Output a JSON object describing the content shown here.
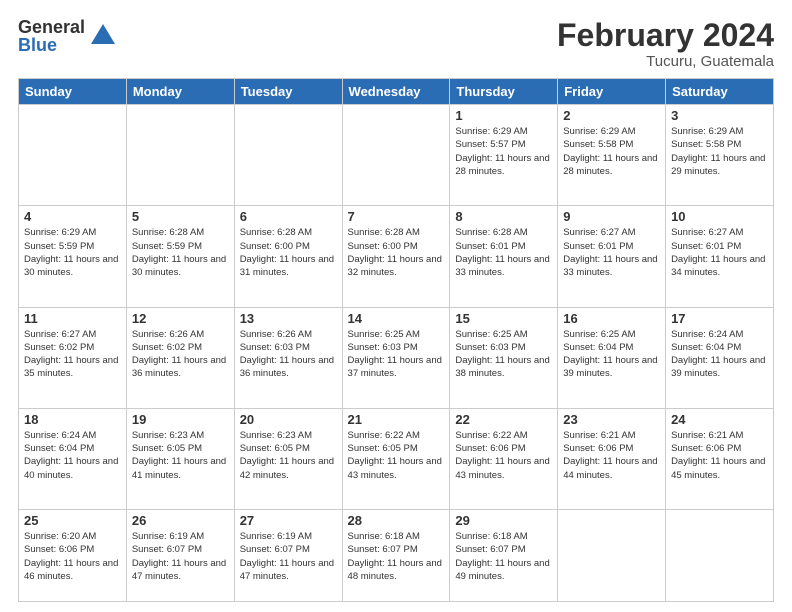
{
  "logo": {
    "general": "General",
    "blue": "Blue"
  },
  "header": {
    "month": "February 2024",
    "location": "Tucuru, Guatemala"
  },
  "weekdays": [
    "Sunday",
    "Monday",
    "Tuesday",
    "Wednesday",
    "Thursday",
    "Friday",
    "Saturday"
  ],
  "weeks": [
    [
      {
        "day": "",
        "info": ""
      },
      {
        "day": "",
        "info": ""
      },
      {
        "day": "",
        "info": ""
      },
      {
        "day": "",
        "info": ""
      },
      {
        "day": "1",
        "sunrise": "6:29 AM",
        "sunset": "5:57 PM",
        "daylight": "11 hours and 28 minutes."
      },
      {
        "day": "2",
        "sunrise": "6:29 AM",
        "sunset": "5:58 PM",
        "daylight": "11 hours and 28 minutes."
      },
      {
        "day": "3",
        "sunrise": "6:29 AM",
        "sunset": "5:58 PM",
        "daylight": "11 hours and 29 minutes."
      }
    ],
    [
      {
        "day": "4",
        "sunrise": "6:29 AM",
        "sunset": "5:59 PM",
        "daylight": "11 hours and 30 minutes."
      },
      {
        "day": "5",
        "sunrise": "6:28 AM",
        "sunset": "5:59 PM",
        "daylight": "11 hours and 30 minutes."
      },
      {
        "day": "6",
        "sunrise": "6:28 AM",
        "sunset": "6:00 PM",
        "daylight": "11 hours and 31 minutes."
      },
      {
        "day": "7",
        "sunrise": "6:28 AM",
        "sunset": "6:00 PM",
        "daylight": "11 hours and 32 minutes."
      },
      {
        "day": "8",
        "sunrise": "6:28 AM",
        "sunset": "6:01 PM",
        "daylight": "11 hours and 33 minutes."
      },
      {
        "day": "9",
        "sunrise": "6:27 AM",
        "sunset": "6:01 PM",
        "daylight": "11 hours and 33 minutes."
      },
      {
        "day": "10",
        "sunrise": "6:27 AM",
        "sunset": "6:01 PM",
        "daylight": "11 hours and 34 minutes."
      }
    ],
    [
      {
        "day": "11",
        "sunrise": "6:27 AM",
        "sunset": "6:02 PM",
        "daylight": "11 hours and 35 minutes."
      },
      {
        "day": "12",
        "sunrise": "6:26 AM",
        "sunset": "6:02 PM",
        "daylight": "11 hours and 36 minutes."
      },
      {
        "day": "13",
        "sunrise": "6:26 AM",
        "sunset": "6:03 PM",
        "daylight": "11 hours and 36 minutes."
      },
      {
        "day": "14",
        "sunrise": "6:25 AM",
        "sunset": "6:03 PM",
        "daylight": "11 hours and 37 minutes."
      },
      {
        "day": "15",
        "sunrise": "6:25 AM",
        "sunset": "6:03 PM",
        "daylight": "11 hours and 38 minutes."
      },
      {
        "day": "16",
        "sunrise": "6:25 AM",
        "sunset": "6:04 PM",
        "daylight": "11 hours and 39 minutes."
      },
      {
        "day": "17",
        "sunrise": "6:24 AM",
        "sunset": "6:04 PM",
        "daylight": "11 hours and 39 minutes."
      }
    ],
    [
      {
        "day": "18",
        "sunrise": "6:24 AM",
        "sunset": "6:04 PM",
        "daylight": "11 hours and 40 minutes."
      },
      {
        "day": "19",
        "sunrise": "6:23 AM",
        "sunset": "6:05 PM",
        "daylight": "11 hours and 41 minutes."
      },
      {
        "day": "20",
        "sunrise": "6:23 AM",
        "sunset": "6:05 PM",
        "daylight": "11 hours and 42 minutes."
      },
      {
        "day": "21",
        "sunrise": "6:22 AM",
        "sunset": "6:05 PM",
        "daylight": "11 hours and 43 minutes."
      },
      {
        "day": "22",
        "sunrise": "6:22 AM",
        "sunset": "6:06 PM",
        "daylight": "11 hours and 43 minutes."
      },
      {
        "day": "23",
        "sunrise": "6:21 AM",
        "sunset": "6:06 PM",
        "daylight": "11 hours and 44 minutes."
      },
      {
        "day": "24",
        "sunrise": "6:21 AM",
        "sunset": "6:06 PM",
        "daylight": "11 hours and 45 minutes."
      }
    ],
    [
      {
        "day": "25",
        "sunrise": "6:20 AM",
        "sunset": "6:06 PM",
        "daylight": "11 hours and 46 minutes."
      },
      {
        "day": "26",
        "sunrise": "6:19 AM",
        "sunset": "6:07 PM",
        "daylight": "11 hours and 47 minutes."
      },
      {
        "day": "27",
        "sunrise": "6:19 AM",
        "sunset": "6:07 PM",
        "daylight": "11 hours and 47 minutes."
      },
      {
        "day": "28",
        "sunrise": "6:18 AM",
        "sunset": "6:07 PM",
        "daylight": "11 hours and 48 minutes."
      },
      {
        "day": "29",
        "sunrise": "6:18 AM",
        "sunset": "6:07 PM",
        "daylight": "11 hours and 49 minutes."
      },
      {
        "day": "",
        "info": ""
      },
      {
        "day": "",
        "info": ""
      }
    ]
  ],
  "labels": {
    "sunrise": "Sunrise:",
    "sunset": "Sunset:",
    "daylight": "Daylight:"
  }
}
